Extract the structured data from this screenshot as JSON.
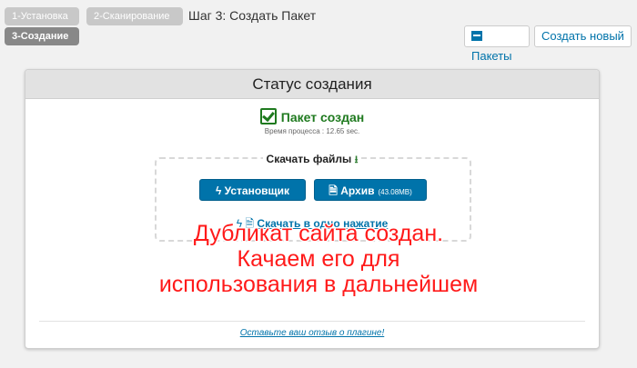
{
  "steps": {
    "step1": "1-Установка",
    "step2": "2-Сканирование",
    "step3": "3-Создание",
    "title": "Шаг 3: Создать Пакет"
  },
  "toolbar": {
    "packages_label": "Пакеты",
    "create_new_label": "Создать новый"
  },
  "panel": {
    "title": "Статус создания",
    "status": "Пакет создан",
    "process_time": "Время процесса : 12.65 sec.",
    "download_label": "Скачать файлы",
    "installer_label": "Установщик",
    "archive_label": "Архив",
    "archive_size": "(43.08MB)",
    "one_click_label": "Скачать в одно нажатие",
    "feedback_link": "Оставьте ваш отзыв о плагине!"
  },
  "overlay": {
    "line1": "Дубликат сайта создан.",
    "line2": "Качаем его для",
    "line3": "использования в дальнейшем"
  },
  "colors": {
    "accent": "#0073aa",
    "success": "#1f7a1f",
    "caption": "#ff1a1a"
  }
}
